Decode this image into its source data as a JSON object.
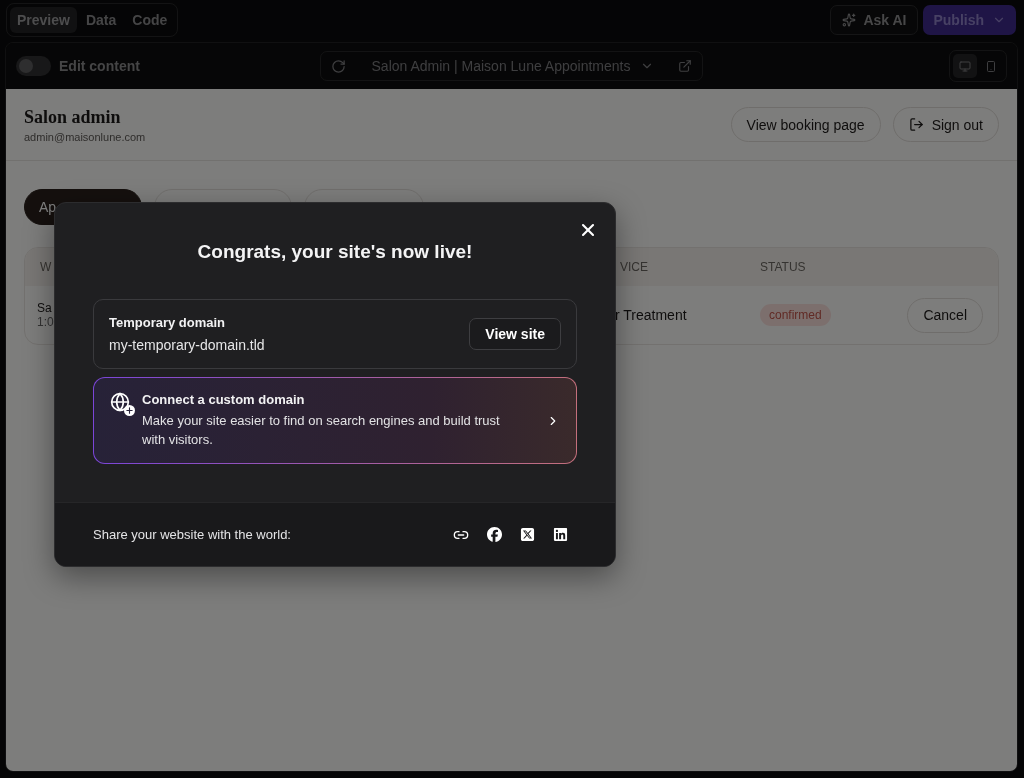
{
  "top_bar": {
    "tabs": [
      {
        "label": "Preview",
        "selected": true
      },
      {
        "label": "Data",
        "selected": false
      },
      {
        "label": "Code",
        "selected": false
      }
    ],
    "ask_ai": "Ask AI",
    "publish": "Publish"
  },
  "toolbar": {
    "edit_toggle": {
      "label": "Edit content",
      "on": false
    },
    "page_select": "Salon Admin | Maison Lune Appointments",
    "devices": [
      {
        "kind": "desktop",
        "selected": true
      },
      {
        "kind": "mobile",
        "selected": false
      }
    ]
  },
  "page": {
    "title": "Salon admin",
    "email": "admin@maisonlune.com",
    "view_booking": "View booking page",
    "sign_out": "Sign out",
    "tabs": [
      {
        "label": "Ap",
        "selected": true
      },
      {
        "selected": false
      },
      {
        "selected": false
      }
    ],
    "table": {
      "columns": [
        "W",
        "VICE",
        "STATUS"
      ],
      "rows": [
        {
          "name": "Sa",
          "time": "1:0",
          "service": "r Treatment",
          "status": "confirmed",
          "action": "Cancel"
        }
      ]
    }
  },
  "modal": {
    "title": "Congrats, your site's now live!",
    "temp_domain": {
      "label": "Temporary domain",
      "value": "my-temporary-domain.tld",
      "button": "View site"
    },
    "custom_domain": {
      "title": "Connect a custom domain",
      "description": "Make your site easier to find on search engines and build trust with visitors."
    },
    "share": {
      "label": "Share your website with the world:",
      "icons": [
        {
          "kind": "link"
        },
        {
          "kind": "facebook"
        },
        {
          "kind": "x"
        },
        {
          "kind": "linkedin"
        }
      ]
    }
  }
}
